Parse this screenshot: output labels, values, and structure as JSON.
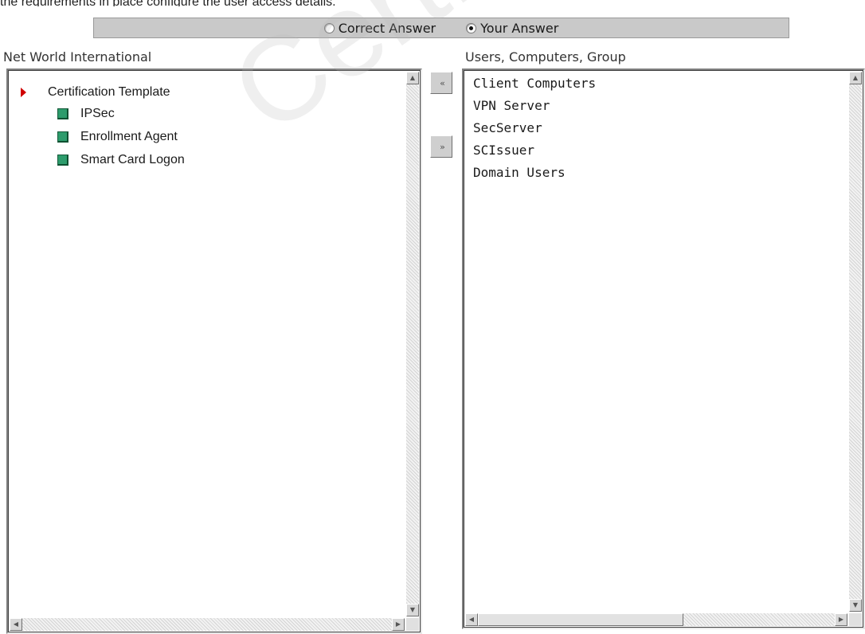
{
  "header_clipped_text": "the requirements in place configure the user access details.",
  "toggle": {
    "option_correct": "Correct Answer",
    "option_yours": "Your Answer",
    "selected": "Your Answer"
  },
  "left_pane": {
    "label": "Net World International",
    "root": "Certification Template",
    "items": [
      "IPSec",
      "Enrollment Agent",
      "Smart Card Logon"
    ]
  },
  "right_pane": {
    "label": "Users, Computers, Group",
    "items": [
      "Client Computers",
      "VPN Server",
      "SecServer",
      "SCIssuer",
      "Domain Users"
    ]
  },
  "buttons": {
    "move_left": "«",
    "move_right": "»"
  },
  "watermark": "CertKiller",
  "icons": {
    "root": "red-arrow-icon",
    "item": "green-square-icon"
  }
}
